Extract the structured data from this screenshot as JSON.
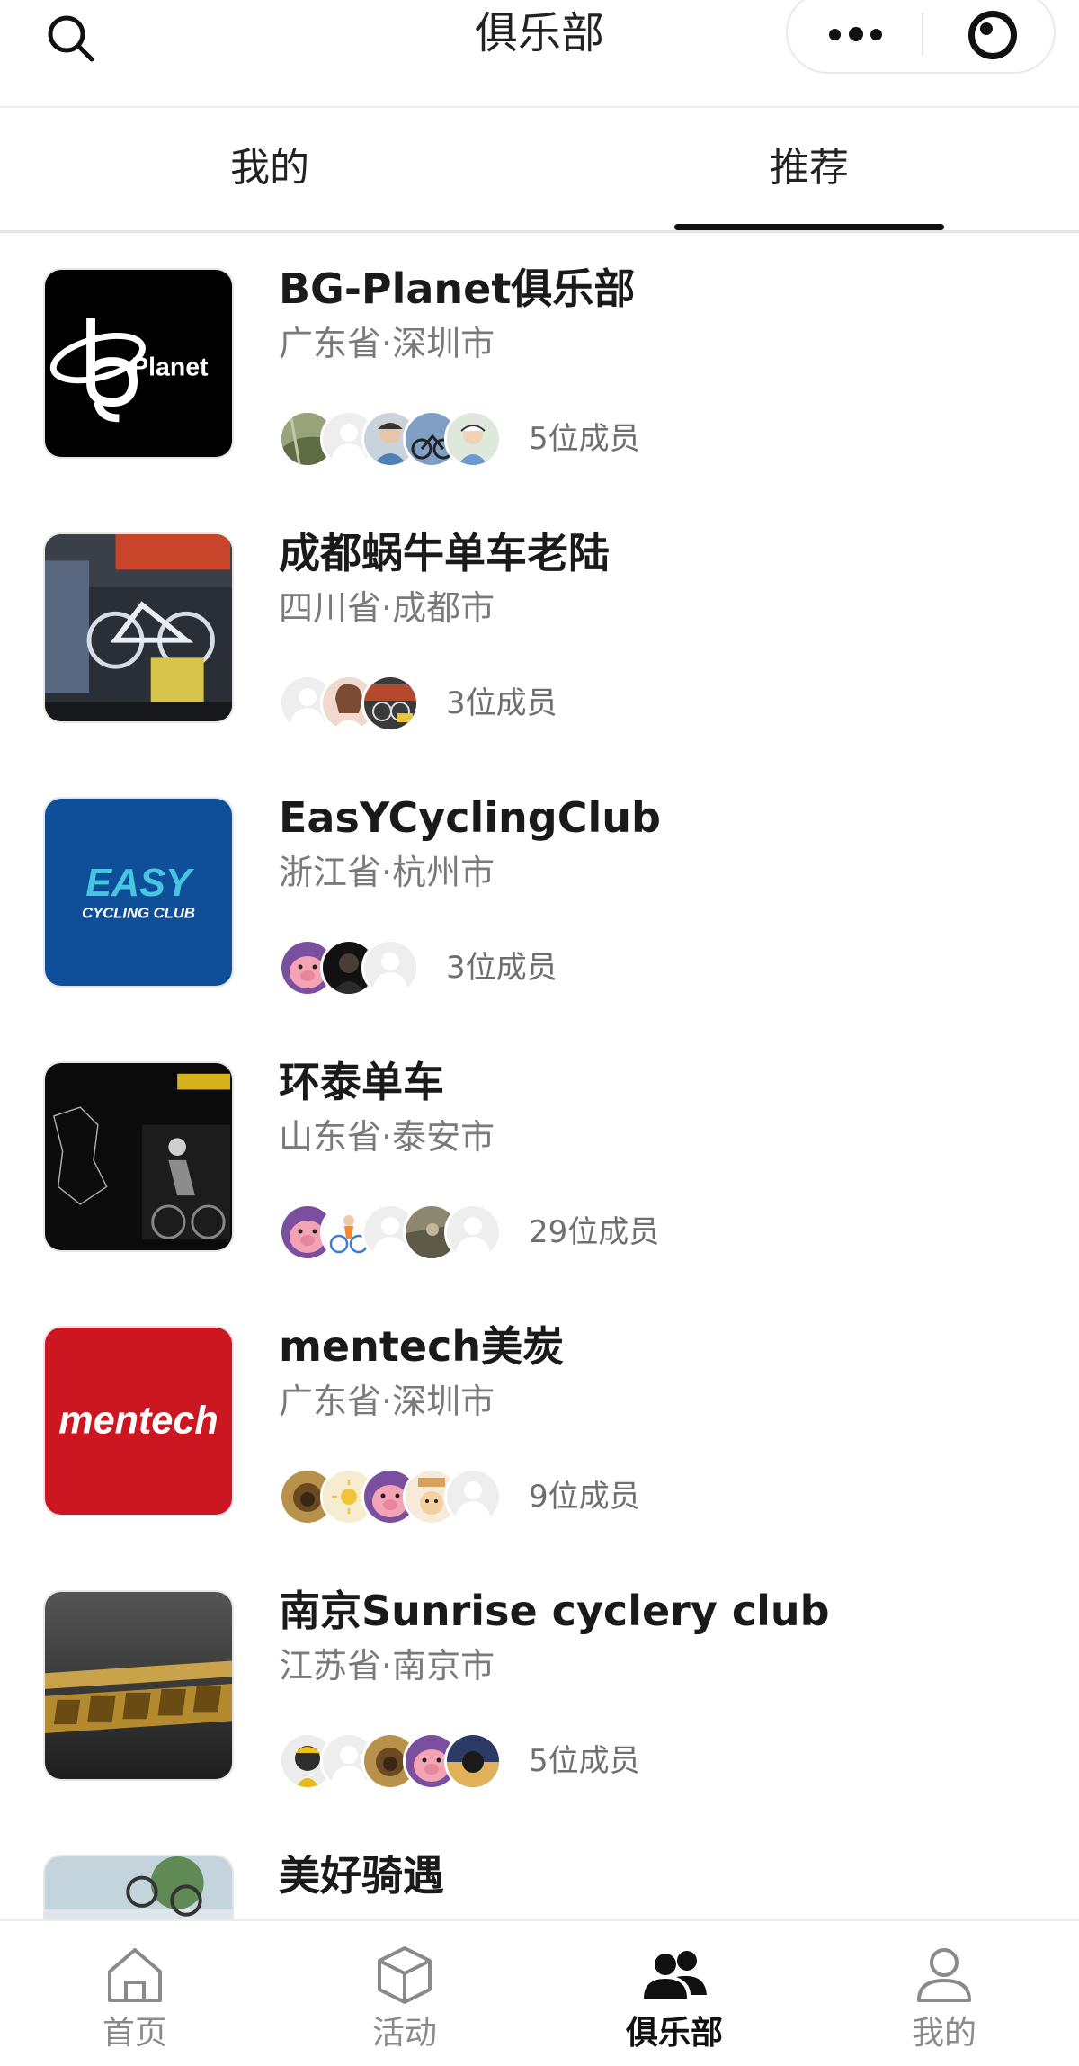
{
  "header": {
    "title": "俱乐部"
  },
  "tabs": [
    {
      "label": "我的"
    },
    {
      "label": "推荐"
    }
  ],
  "clubs": [
    {
      "name": "BG-Planet俱乐部",
      "location": "广东省·深圳市",
      "member_count": "5位成员",
      "logo_text": "Planet"
    },
    {
      "name": "成都蜗牛单车老陆",
      "location": "四川省·成都市",
      "member_count": "3位成员"
    },
    {
      "name": "EasYCyclingClub",
      "location": "浙江省·杭州市",
      "member_count": "3位成员",
      "logo_text": "EASY",
      "logo_subtext": "CYCLING CLUB"
    },
    {
      "name": "环泰单车",
      "location": "山东省·泰安市",
      "member_count": "29位成员"
    },
    {
      "name": "mentech美炭",
      "location": "广东省·深圳市",
      "member_count": "9位成员",
      "logo_text": "mentech"
    },
    {
      "name": "南京Sunrise cyclery club",
      "location": "江苏省·南京市",
      "member_count": "5位成员"
    },
    {
      "name": "美好骑遇"
    }
  ],
  "bottom_nav": [
    {
      "label": "首页",
      "icon": "home-icon"
    },
    {
      "label": "活动",
      "icon": "cube-icon"
    },
    {
      "label": "俱乐部",
      "icon": "group-icon",
      "active": true
    },
    {
      "label": "我的",
      "icon": "person-icon"
    }
  ],
  "colors": {
    "active": "#111111",
    "inactive": "#8a8a8a",
    "easy_blue": "#0f4f9a",
    "mentech_red": "#cc1722"
  }
}
